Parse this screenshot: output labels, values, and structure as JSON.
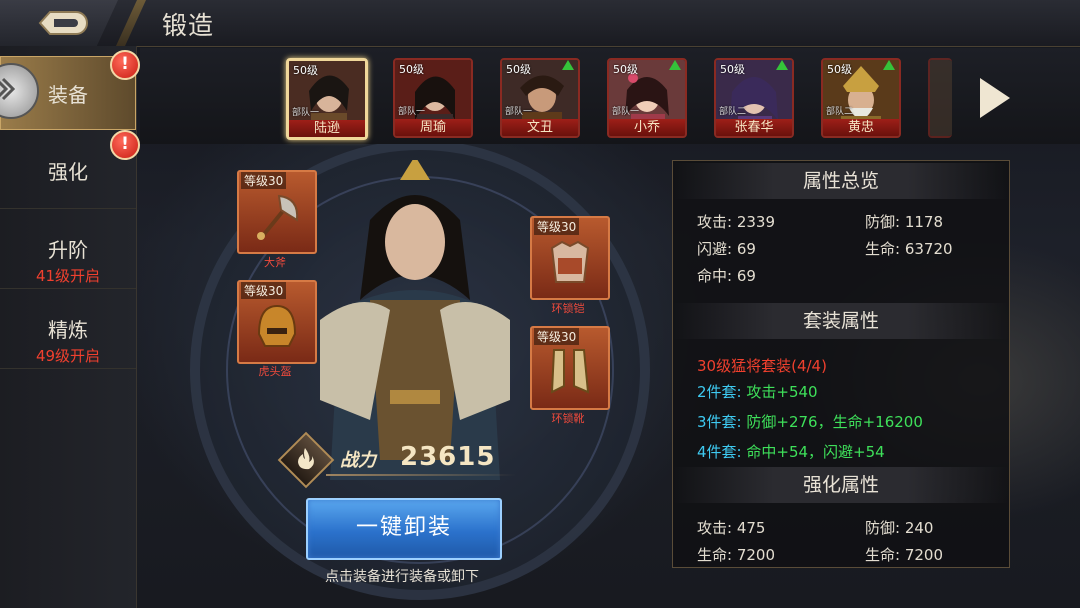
{
  "header": {
    "title": "锻造"
  },
  "nav": {
    "items": [
      {
        "label": "装备",
        "sub": "",
        "active": true,
        "badge": "!"
      },
      {
        "label": "强化",
        "sub": "",
        "active": false,
        "badge": "!"
      },
      {
        "label": "升阶",
        "sub": "41级开启",
        "active": false
      },
      {
        "label": "精炼",
        "sub": "49级开启",
        "active": false
      }
    ]
  },
  "heroes": [
    {
      "level": "50级",
      "team": "部队一",
      "name": "陆逊",
      "selected": true,
      "upgrade": false
    },
    {
      "level": "50级",
      "team": "部队一",
      "name": "周瑜",
      "selected": false,
      "upgrade": false
    },
    {
      "level": "50级",
      "team": "部队一",
      "name": "文丑",
      "selected": false,
      "upgrade": true
    },
    {
      "level": "50级",
      "team": "部队一",
      "name": "小乔",
      "selected": false,
      "upgrade": true
    },
    {
      "level": "50级",
      "team": "部队二",
      "name": "张春华",
      "selected": false,
      "upgrade": true
    },
    {
      "level": "50级",
      "team": "部队二",
      "name": "黄忠",
      "selected": false,
      "upgrade": true
    }
  ],
  "equipment": {
    "weapon": {
      "level": "等级30",
      "name": "大斧"
    },
    "helmet": {
      "level": "等级30",
      "name": "虎头盔"
    },
    "armor": {
      "level": "等级30",
      "name": "环锁铠"
    },
    "boots": {
      "level": "等级30",
      "name": "环锁靴"
    }
  },
  "power": {
    "label": "战力",
    "value": "23615"
  },
  "unequip_button": "一键卸装",
  "hint": "点击装备进行装备或卸下",
  "stats": {
    "overview_title": "属性总览",
    "attack": {
      "label": "攻击:",
      "value": "2339"
    },
    "defense": {
      "label": "防御:",
      "value": "1178"
    },
    "dodge": {
      "label": "闪避:",
      "value": "69"
    },
    "hp": {
      "label": "生命:",
      "value": "63720"
    },
    "hit": {
      "label": "命中:",
      "value": "69"
    },
    "set_title": "套装属性",
    "set_name": "30级猛将套装(4/4)",
    "set2_label": "2件套:",
    "set2_value": "攻击+540",
    "set3_label": "3件套:",
    "set3_value": "防御+276，生命+16200",
    "set4_label": "4件套:",
    "set4_value": "命中+54，闪避+54",
    "enhance_title": "强化属性",
    "e_attack": {
      "label": "攻击:",
      "value": "475"
    },
    "e_defense": {
      "label": "防御:",
      "value": "240"
    },
    "e_hp1": {
      "label": "生命:",
      "value": "7200"
    },
    "e_hp2": {
      "label": "生命:",
      "value": "7200"
    }
  },
  "colors": {
    "accent_gold": "#c9a566",
    "warning_red": "#f0402e",
    "set_cyan": "#3ec9f0",
    "set_green": "#3ee05a",
    "button_blue": "#2b72cc"
  }
}
